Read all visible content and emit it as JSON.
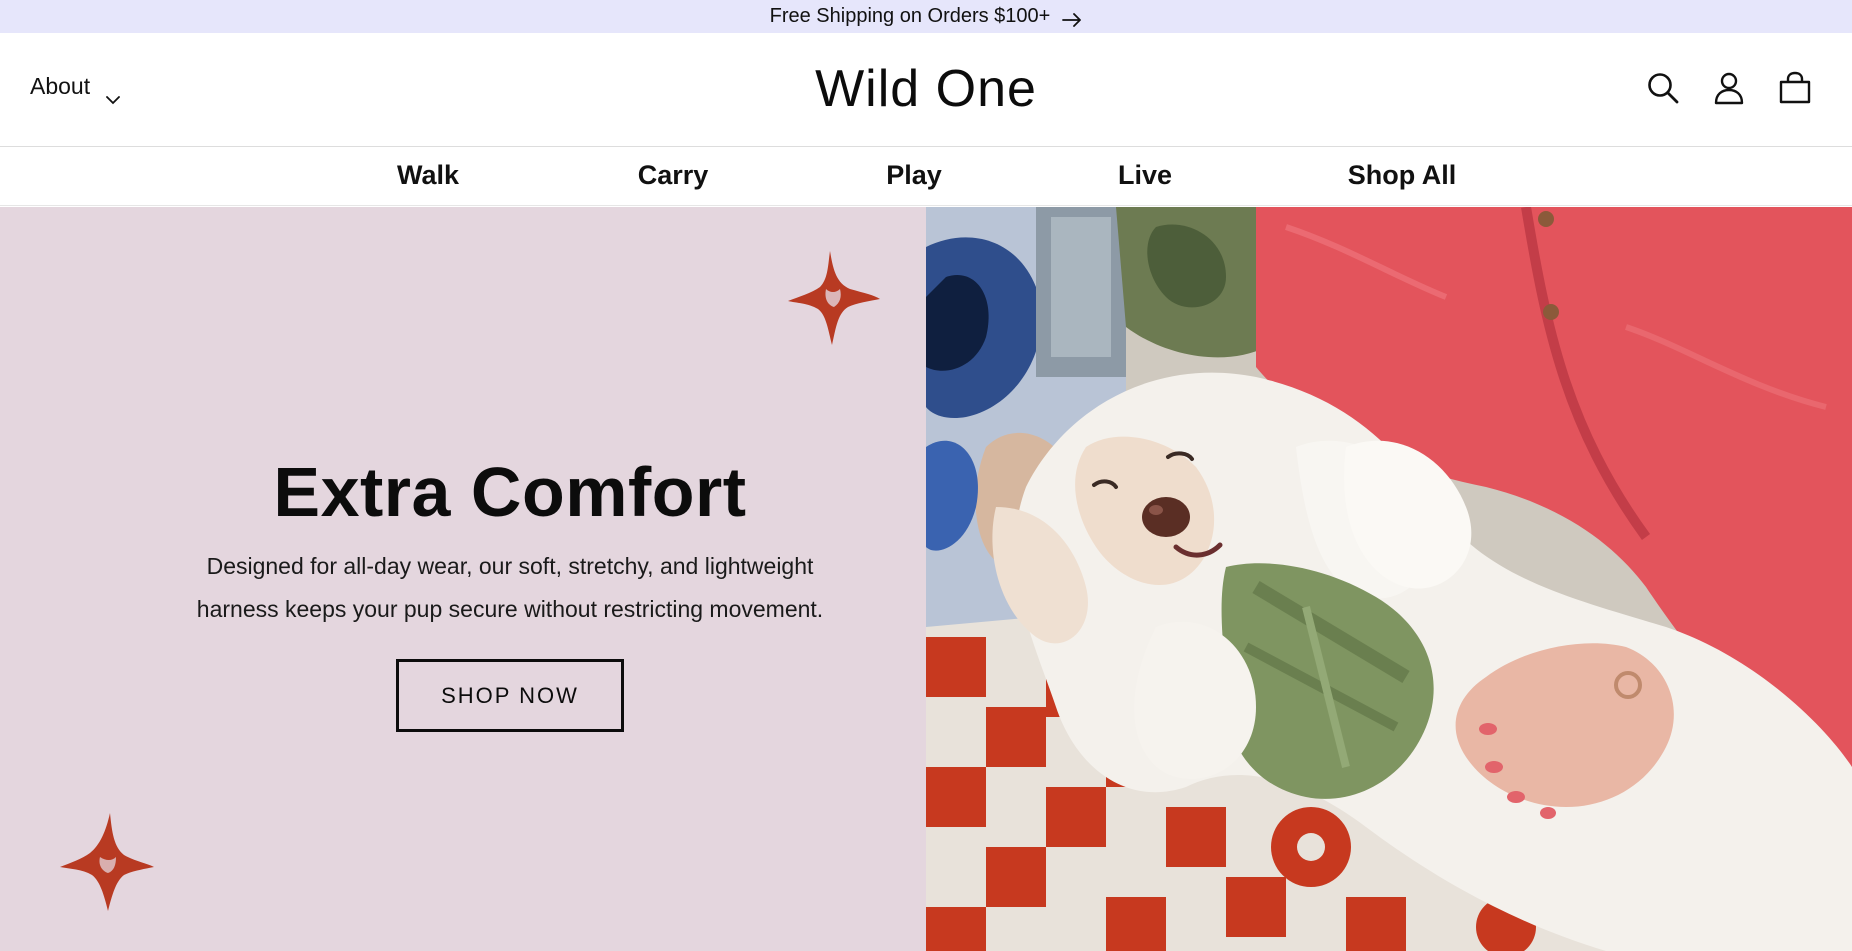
{
  "announcement": {
    "text": "Free Shipping on Orders $100+",
    "icon": "arrow-right-icon"
  },
  "header": {
    "about_label": "About",
    "logo": "Wild One",
    "icons": [
      "search-icon",
      "account-icon",
      "cart-icon"
    ]
  },
  "nav": {
    "items": [
      {
        "label": "Walk"
      },
      {
        "label": "Carry"
      },
      {
        "label": "Play"
      },
      {
        "label": "Live"
      },
      {
        "label": "Shop All"
      }
    ]
  },
  "hero": {
    "title": "Extra Comfort",
    "body_line1": "Designed for all-day wear, our soft, stretchy, and lightweight",
    "body_line2": "harness keeps your pup secure without restricting movement.",
    "cta_label": "SHOP NOW",
    "image": "white fluffy dog wearing green harness on owner's lap",
    "colors": {
      "panel_bg": "#e4d6de",
      "sparkle": "#b83a22",
      "announcement_bg": "#e6e6fb"
    }
  }
}
